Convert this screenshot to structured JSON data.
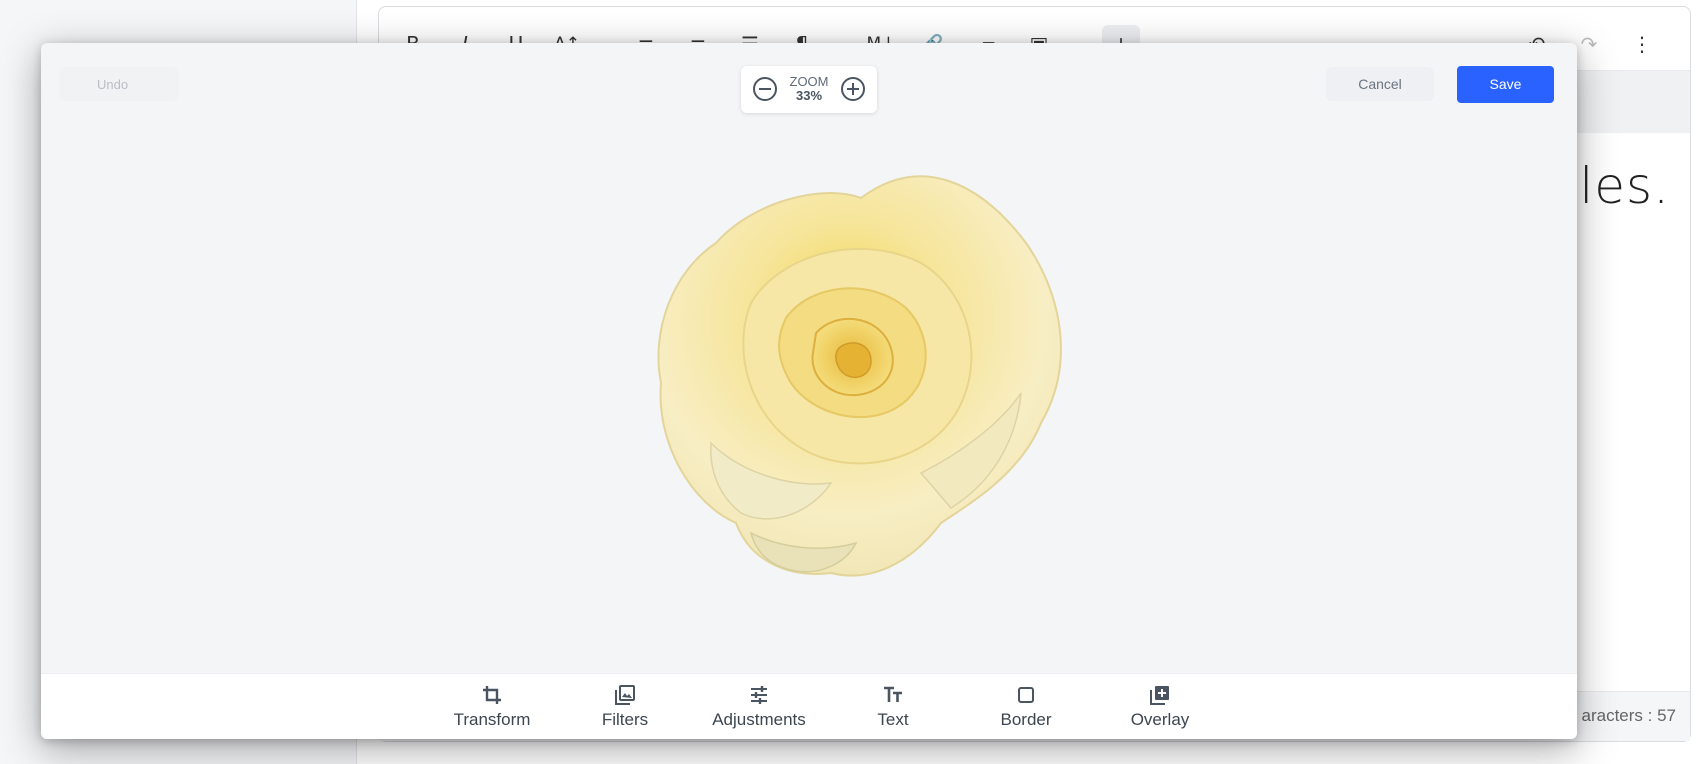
{
  "background_editor": {
    "toolbar": {
      "bold": "B",
      "italic": "I",
      "underline": "U",
      "font_size": "A↕",
      "align_left": "≡",
      "align_center": "≡",
      "ordered_list": "☰",
      "paragraph": "¶",
      "markdown": "M↓",
      "link": "🔗",
      "folder": "▰",
      "image": "▣",
      "insert": "+",
      "undo": "↶",
      "redo": "↷",
      "more": "⋮"
    },
    "body_text": "files.",
    "footer": {
      "char_count": "aracters : 57"
    }
  },
  "image_editor": {
    "undo_label": "Undo",
    "zoom": {
      "label": "ZOOM",
      "value": "33%"
    },
    "cancel_label": "Cancel",
    "save_label": "Save",
    "tabs": [
      {
        "label": "Transform",
        "icon": "crop-icon"
      },
      {
        "label": "Filters",
        "icon": "filters-icon"
      },
      {
        "label": "Adjustments",
        "icon": "sliders-icon"
      },
      {
        "label": "Text",
        "icon": "text-icon"
      },
      {
        "label": "Border",
        "icon": "square-icon"
      },
      {
        "label": "Overlay",
        "icon": "add-layer-icon"
      }
    ]
  },
  "colors": {
    "primary": "#2962ff",
    "modal_bg": "#f4f5f7",
    "icon": "#4a5561"
  }
}
